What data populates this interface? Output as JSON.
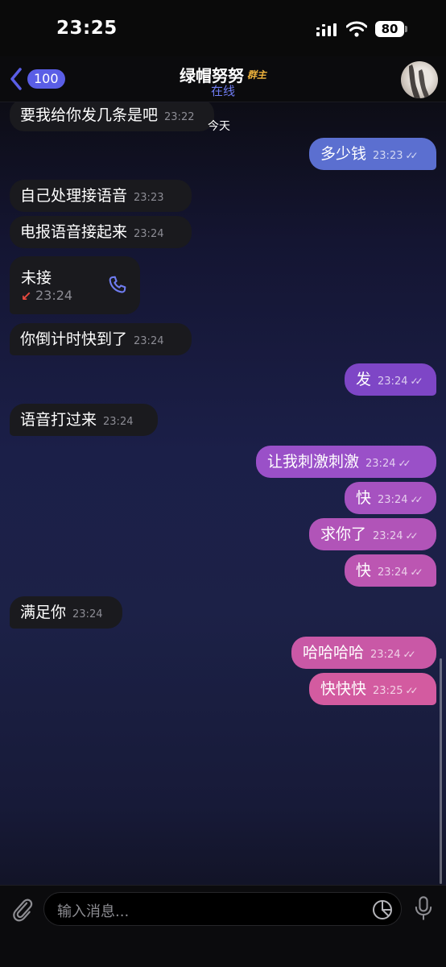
{
  "status_bar": {
    "time": "23:25",
    "battery": "80"
  },
  "header": {
    "back_count": "100",
    "title": "绿帽努努",
    "role": "群主",
    "status": "在线"
  },
  "date_chip": "今天",
  "messages": [
    {
      "dir": "in",
      "text": "要我给你发几条是吧",
      "time": "23:22"
    },
    {
      "dir": "out",
      "text": "多少钱",
      "time": "23:23"
    },
    {
      "dir": "in",
      "text": "自己处理接语音",
      "time": "23:23"
    },
    {
      "dir": "in",
      "text": "电报语音接起来",
      "time": "23:24"
    },
    {
      "dir": "in",
      "text": "你倒计时快到了",
      "time": "23:24"
    },
    {
      "dir": "out",
      "text": "发",
      "time": "23:24"
    },
    {
      "dir": "in",
      "text": "语音打过来",
      "time": "23:24"
    },
    {
      "dir": "out",
      "text": "让我刺激刺激",
      "time": "23:24"
    },
    {
      "dir": "out",
      "text": "快",
      "time": "23:24"
    },
    {
      "dir": "out",
      "text": "求你了",
      "time": "23:24"
    },
    {
      "dir": "out",
      "text": "快",
      "time": "23:24"
    },
    {
      "dir": "in",
      "text": "满足你",
      "time": "23:24"
    },
    {
      "dir": "out",
      "text": "哈哈哈哈",
      "time": "23:24"
    },
    {
      "dir": "out",
      "text": "快快快",
      "time": "23:25"
    }
  ],
  "call": {
    "title": "未接",
    "time": "23:24"
  },
  "input": {
    "placeholder": "输入消息..."
  },
  "colors": {
    "accent": "#5a5ee6",
    "incoming_bubble": "#1a1a1e",
    "outgoing_blue": "#5b6fd0",
    "outgoing_purple": "#8a4ac9",
    "outgoing_pink": "#d35ba0",
    "missed_call": "#e8493f",
    "role_badge": "#f0b43c"
  },
  "icons": [
    "back-chevron-icon",
    "signal-icon",
    "wifi-icon",
    "phone-icon",
    "missed-call-arrow-icon",
    "read-ticks-icon",
    "paperclip-icon",
    "sticker-icon",
    "microphone-icon"
  ]
}
